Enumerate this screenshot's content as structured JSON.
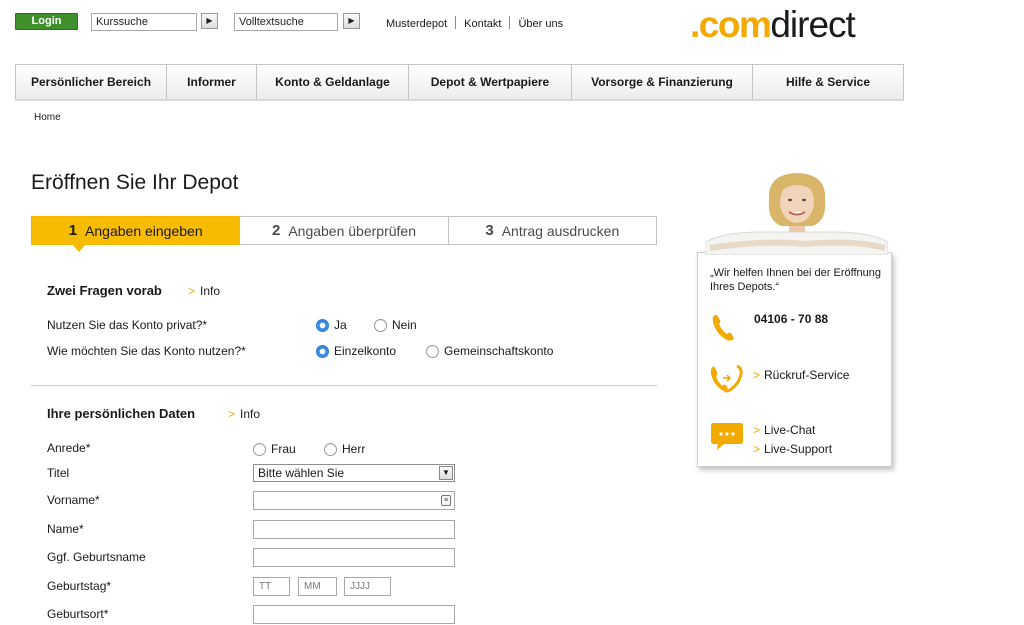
{
  "header": {
    "login_label": "Login",
    "kurssuche_value": "Kurssuche",
    "volltextsuche_value": "Volltextsuche",
    "go_icon": "play-arrow-icon",
    "links": [
      "Musterdepot",
      "Kontakt",
      "Über uns"
    ],
    "logo": {
      "dot": ".",
      "com": "com",
      "direct": "direct"
    }
  },
  "nav": {
    "items": [
      "Persönlicher Bereich",
      "Informer",
      "Konto & Geldanlage",
      "Depot & Wertpapiere",
      "Vorsorge & Finanzierung",
      "Hilfe & Service"
    ]
  },
  "breadcrumb": "Home",
  "page_title": "Eröffnen Sie Ihr Depot",
  "steps": [
    {
      "num": "1",
      "label": "Angaben eingeben",
      "active": true
    },
    {
      "num": "2",
      "label": "Angaben überprüfen",
      "active": false
    },
    {
      "num": "3",
      "label": "Antrag ausdrucken",
      "active": false
    }
  ],
  "section1": {
    "title": "Zwei Fragen vorab",
    "info": "Info",
    "q1": {
      "label": "Nutzen Sie das Konto privat?*",
      "options": [
        "Ja",
        "Nein"
      ],
      "selected": "Ja"
    },
    "q2": {
      "label": "Wie möchten Sie das Konto nutzen?*",
      "options": [
        "Einzelkonto",
        "Gemeinschaftskonto"
      ],
      "selected": "Einzelkonto"
    }
  },
  "section2": {
    "title": "Ihre persönlichen Daten",
    "info": "Info",
    "anrede": {
      "label": "Anrede*",
      "options": [
        "Frau",
        "Herr"
      ]
    },
    "titel": {
      "label": "Titel",
      "selected": "Bitte wählen Sie"
    },
    "vorname": {
      "label": "Vorname*"
    },
    "name": {
      "label": "Name*"
    },
    "geburtsname": {
      "label": "Ggf. Geburtsname"
    },
    "geburtstag": {
      "label": "Geburtstag*",
      "placeholders": [
        "TT",
        "MM",
        "JJJJ"
      ]
    },
    "geburtsort": {
      "label": "Geburtsort*"
    }
  },
  "help": {
    "quote": "„Wir helfen Ihnen bei der Eröffnung Ihres Depots.“",
    "phone": "04106 - 70 88",
    "rueckruf": "Rückruf-Service",
    "live_chat": "Live-Chat",
    "live_support": "Live-Support",
    "accent_color": "#f2a900"
  },
  "colors": {
    "brand_yellow": "#f7bb00",
    "login_green": "#3f8f2b",
    "radio_blue": "#3b8fe6"
  }
}
